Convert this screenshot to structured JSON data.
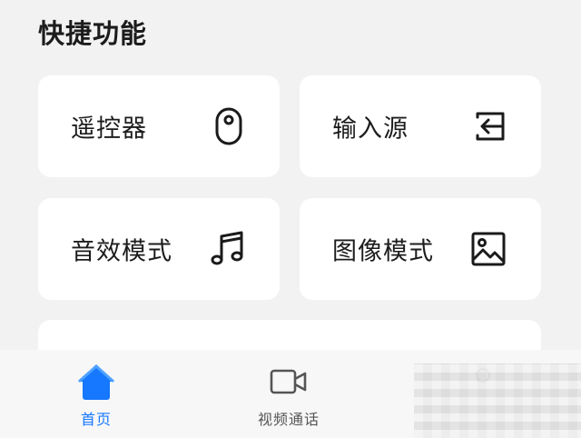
{
  "section": {
    "title": "快捷功能"
  },
  "cards": [
    {
      "label": "遥控器",
      "icon": "remote-icon"
    },
    {
      "label": "输入源",
      "icon": "input-source-icon"
    },
    {
      "label": "音效模式",
      "icon": "music-note-icon"
    },
    {
      "label": "图像模式",
      "icon": "image-icon"
    }
  ],
  "bottom_nav": {
    "items": [
      {
        "label": "首页",
        "icon": "home-icon",
        "active": true
      },
      {
        "label": "视频通话",
        "icon": "video-camera-icon",
        "active": false
      },
      {
        "label": "",
        "icon": "user-icon",
        "active": false
      }
    ]
  },
  "colors": {
    "accent": "#1677ff",
    "card_bg": "#ffffff",
    "page_bg": "#f2f2f2"
  }
}
